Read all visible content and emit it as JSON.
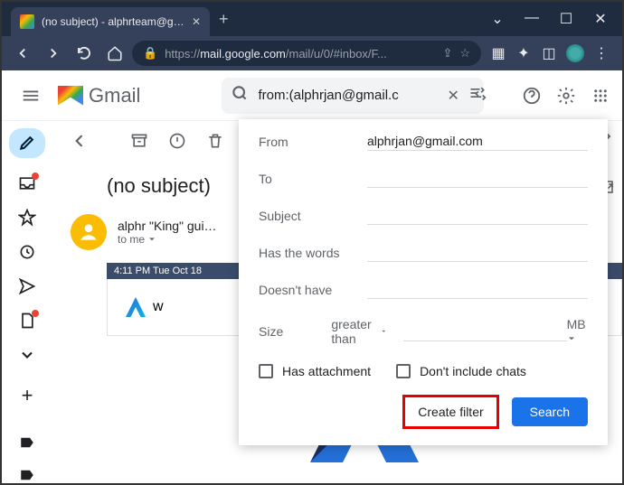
{
  "browser": {
    "tab_title": "(no subject) - alphrteam@gmail.…",
    "url_prefix": "https://",
    "url_host": "mail.google.com",
    "url_path": "/mail/u/0/#inbox/F..."
  },
  "gmail": {
    "product_name": "Gmail",
    "search_value": "from:(alphrjan@gmail.c"
  },
  "message": {
    "subject": "(no subject)",
    "sender_name": "alphr \"King\" gui…",
    "to_line": "to me",
    "banner": "4:11 PM   Tue Oct 18",
    "card_text": "w"
  },
  "filter": {
    "labels": {
      "from": "From",
      "to": "To",
      "subject": "Subject",
      "has_words": "Has the words",
      "doesnt_have": "Doesn't have",
      "size": "Size"
    },
    "from_value": "alphrjan@gmail.com",
    "size_op": "greater than",
    "size_unit": "MB",
    "checks": {
      "has_attachment": "Has attachment",
      "no_chats": "Don't include chats"
    },
    "actions": {
      "create_filter": "Create filter",
      "search": "Search"
    }
  }
}
